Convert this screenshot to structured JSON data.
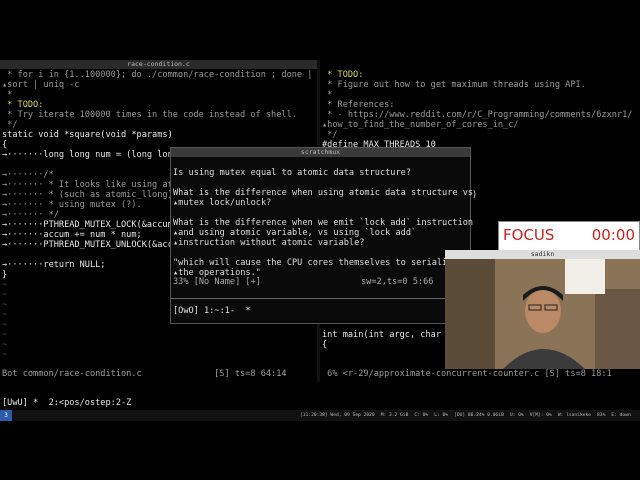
{
  "left_pane": {
    "title": "race-condition.c",
    "lines": [
      {
        "text": " * for i in {1..100000}; do ./common/race-condition ; done |",
        "cls": "c-grey"
      },
      {
        "text": "▴sort | uniq -c",
        "cls": "c-grey"
      },
      {
        "text": " *",
        "cls": "c-grey"
      },
      {
        "text": " * TODO:",
        "cls": "c-todo"
      },
      {
        "text": " * Try iterate 100000 times in the code instead of shell.",
        "cls": "c-grey"
      },
      {
        "text": " */",
        "cls": "c-grey"
      },
      {
        "text": "static void *square(void *params)",
        "cls": "c-white"
      },
      {
        "text": "{",
        "cls": "c-white"
      },
      {
        "text": "→·······long long num = (long long",
        "cls": "c-white"
      },
      {
        "text": "",
        "cls": "c-white"
      },
      {
        "text": "→·······/*",
        "cls": "c-grey"
      },
      {
        "text": "→······· * It looks like using ato",
        "cls": "c-grey"
      },
      {
        "text": "→······· * (such as atomic_llong)",
        "cls": "c-grey"
      },
      {
        "text": "→······· * using mutex (?).",
        "cls": "c-grey"
      },
      {
        "text": "→······· */",
        "cls": "c-grey"
      },
      {
        "text": "→·······PTHREAD_MUTEX_LOCK(&accum",
        "cls": "c-white"
      },
      {
        "text": "→·······accum += num * num;",
        "cls": "c-white"
      },
      {
        "text": "→·······PTHREAD_MUTEX_UNLOCK(&accu",
        "cls": "c-white"
      },
      {
        "text": "",
        "cls": "c-white"
      },
      {
        "text": "→·······return NULL;",
        "cls": "c-white"
      },
      {
        "text": "}",
        "cls": "c-white"
      },
      {
        "text": "~",
        "cls": "tilde"
      },
      {
        "text": "~",
        "cls": "tilde"
      },
      {
        "text": "~",
        "cls": "tilde"
      },
      {
        "text": "~",
        "cls": "tilde"
      },
      {
        "text": "~",
        "cls": "tilde"
      },
      {
        "text": "~",
        "cls": "tilde"
      },
      {
        "text": "~",
        "cls": "tilde"
      },
      {
        "text": "~",
        "cls": "tilde"
      }
    ],
    "status": "Bot common/race-condition.c              [S] ts=8 64:14"
  },
  "right_pane": {
    "lines": [
      {
        "text": " * TODO:",
        "cls": "c-todo"
      },
      {
        "text": " * Figure out how to get maximum threads using API.",
        "cls": "c-grey"
      },
      {
        "text": " *",
        "cls": "c-grey"
      },
      {
        "text": " * References:",
        "cls": "c-grey"
      },
      {
        "text": " * - https://www.reddit.com/r/C_Programming/comments/6zxnr1/",
        "cls": "c-grey"
      },
      {
        "text": "▴how_to_find_the_number_of_cores_in_c/",
        "cls": "c-grey"
      },
      {
        "text": " */",
        "cls": "c-grey"
      },
      {
        "text": "#define MAX_THREADS 10",
        "cls": "c-white"
      },
      {
        "text": "",
        "cls": "c-white"
      },
      {
        "text": "                 k) \\",
        "cls": "c-white"
      },
      {
        "text": "                 _lock(lock))",
        "cls": "c-white"
      },
      {
        "text": "                 ock) \\",
        "cls": "c-white"
      },
      {
        "text": "                 unlock(lock))",
        "cls": "c-white"
      },
      {
        "text": "",
        "cls": "c-white"
      },
      {
        "text": "",
        "cls": "c-white"
      },
      {
        "text": "                 ifier",
        "cls": "c-white"
      },
      {
        "text": "",
        "cls": "c-white"
      },
      {
        "text": "                 rflow",
        "cls": "c-white"
      },
      {
        "text": "",
        "cls": "c-white"
      },
      {
        "text": "",
        "cls": "c-white"
      },
      {
        "text": "",
        "cls": "c-white"
      },
      {
        "text": "",
        "cls": "c-white"
      },
      {
        "text": "",
        "cls": "c-white"
      },
      {
        "text": "",
        "cls": "c-white"
      },
      {
        "text": "static void *thread_exec(",
        "cls": "c-white"
      },
      {
        "text": "",
        "cls": "c-white"
      },
      {
        "text": "int main(int argc, char *",
        "cls": "c-white"
      },
      {
        "text": "{",
        "cls": "c-white"
      },
      {
        "text": "",
        "cls": "c-white"
      },
      {
        "text": "",
        "cls": "c-white"
      }
    ],
    "status": " 6% <r-29/approximate-concurrent-counter.c [S] ts=8 18:1"
  },
  "popup": {
    "title": "scratchmux",
    "lines": [
      "Is using mutex equal to atomic data structure?",
      "",
      "What is the difference when using atomic data structure vs",
      "▴mutex lock/unlock?",
      "",
      "What is the difference when we emit `lock add` instruction",
      "▴and using atomic variable, vs using `lock add`",
      "▴instruction without atomic variable?",
      "",
      "\"which will cause the CPU cores themselves to serialize",
      "▴the operations.\""
    ],
    "status_left": "33% [No Name] [+]",
    "status_right": "sw=2,ts=0 5:66",
    "tmux_bar": "[OwO] 1:~:1-  *"
  },
  "focus_widget": {
    "label": "FOCUS",
    "time": "00:00"
  },
  "webcam": {
    "title": "sadikn"
  },
  "tmux_main_bar": "[UwU] *  2:<pos/ostep:2-Z",
  "sys_bar": {
    "workspace": "3",
    "items": [
      "[11:20:38] Wed, 09 Sep 2020",
      "M: 3.2 GiB",
      "C: 0%",
      "L: 0%",
      "[DU] 86.24% 0.0GiB",
      "U: 0%",
      "V[M]: 0%",
      "W: lsanikeke",
      "83%",
      "E: down"
    ]
  },
  "colors": {
    "focus_red": "#cc2222",
    "blue_text": "#7b8cff",
    "todo_yellow": "#d8d850",
    "cursor": "#dcdcdc"
  }
}
